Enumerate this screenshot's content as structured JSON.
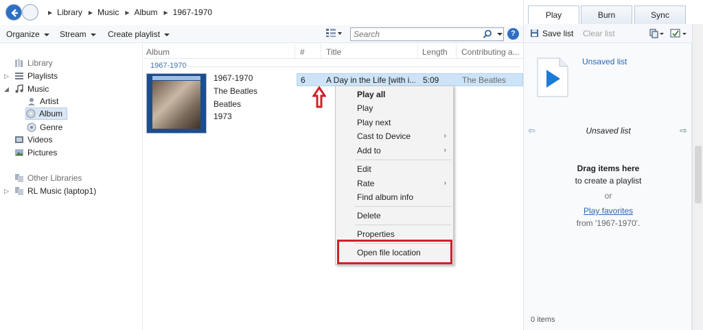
{
  "breadcrumbs": [
    "Library",
    "Music",
    "Album",
    "1967-1970"
  ],
  "toolbar": {
    "organize": "Organize",
    "stream": "Stream",
    "create_playlist": "Create playlist",
    "search_placeholder": "Search"
  },
  "nav": {
    "library": "Library",
    "playlists": "Playlists",
    "music": "Music",
    "artist": "Artist",
    "album": "Album",
    "genre": "Genre",
    "videos": "Videos",
    "pictures": "Pictures",
    "other_libraries": "Other Libraries",
    "rl_music": "RL Music (laptop1)"
  },
  "columns": {
    "album": "Album",
    "number": "#",
    "title": "Title",
    "length": "Length",
    "contributing": "Contributing a..."
  },
  "group_label": "1967-1970",
  "album": {
    "title": "1967-1970",
    "artist": "The Beatles",
    "album_artist": "Beatles",
    "year": "1973"
  },
  "track": {
    "number": "6",
    "title": "A Day in the Life [with i...",
    "length": "5:09",
    "artist": "The Beatles"
  },
  "context_menu": {
    "play_all": "Play all",
    "play": "Play",
    "play_next": "Play next",
    "cast": "Cast to Device",
    "add_to": "Add to",
    "edit": "Edit",
    "rate": "Rate",
    "find_info": "Find album info",
    "delete": "Delete",
    "properties": "Properties",
    "open_location": "Open file location"
  },
  "tabs": {
    "play": "Play",
    "burn": "Burn",
    "sync": "Sync"
  },
  "right_pane": {
    "save_list": "Save list",
    "clear_list": "Clear list",
    "unsaved_link": "Unsaved list",
    "list_title": "Unsaved list",
    "drag_heading": "Drag items here",
    "drag_sub": "to create a playlist",
    "or": "or",
    "play_favorites": "Play favorites",
    "from_text": "from '1967-1970'.",
    "status": "0 items"
  },
  "colors": {
    "accent": "#2a64b7",
    "highlight_red": "#d0202a",
    "selection": "#cde3f7"
  }
}
